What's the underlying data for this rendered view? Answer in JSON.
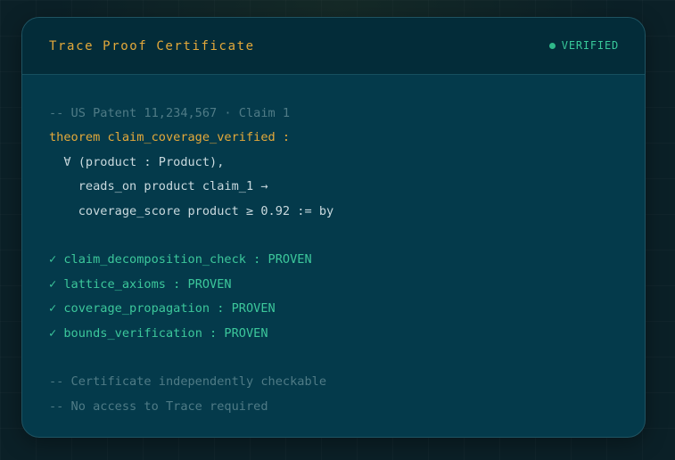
{
  "header": {
    "title": "Trace Proof Certificate",
    "status_label": "VERIFIED"
  },
  "code": {
    "comment_top": "-- US Patent 11,234,567 · Claim 1",
    "theorem_line": "theorem claim_coverage_verified :",
    "forall_line": "  ∀ (product : Product),",
    "reads_line": "    reads_on product claim_1 →",
    "coverage_line": "    coverage_score product ≥ 0.92 := by",
    "checks": [
      {
        "mark": "✓",
        "text": "claim_decomposition_check : PROVEN"
      },
      {
        "mark": "✓",
        "text": "lattice_axioms : PROVEN"
      },
      {
        "mark": "✓",
        "text": "coverage_propagation : PROVEN"
      },
      {
        "mark": "✓",
        "text": "bounds_verification : PROVEN"
      }
    ],
    "comment_bottom_1": "-- Certificate independently checkable",
    "comment_bottom_2": "-- No access to Trace required"
  },
  "colors": {
    "accent": "#e4a93a",
    "success": "#3cc79b",
    "comment": "#4f7b86",
    "card_bg": "#043a4b"
  }
}
